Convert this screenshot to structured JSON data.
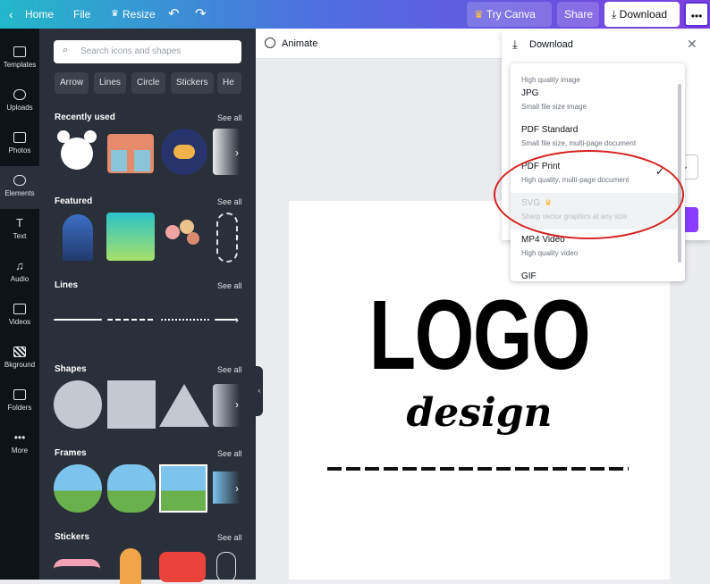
{
  "topbar": {
    "home": "Home",
    "file": "File",
    "resize": "Resize",
    "try": "Try Canva Pro",
    "share": "Share",
    "download": "Download"
  },
  "subbar": {
    "animate": "Animate"
  },
  "rail": [
    {
      "label": "Templates"
    },
    {
      "label": "Uploads"
    },
    {
      "label": "Photos"
    },
    {
      "label": "Elements"
    },
    {
      "label": "Text"
    },
    {
      "label": "Audio"
    },
    {
      "label": "Videos"
    },
    {
      "label": "Bkground"
    },
    {
      "label": "Folders"
    },
    {
      "label": "More"
    }
  ],
  "panel": {
    "search_placeholder": "Search icons and shapes",
    "chips": [
      "Arrow",
      "Lines",
      "Circle",
      "Stickers",
      "He"
    ],
    "see_all": "See all",
    "sections": [
      "Recently used",
      "Featured",
      "Lines",
      "Shapes",
      "Frames",
      "Stickers"
    ]
  },
  "canvas": {
    "logo": "LOGO",
    "design": "design"
  },
  "download_panel": {
    "title": "Download",
    "options": [
      {
        "title": "",
        "desc": "High quality image"
      },
      {
        "title": "JPG",
        "desc": "Small file size image"
      },
      {
        "title": "PDF Standard",
        "desc": "Small file size, multi-page document"
      },
      {
        "title": "PDF Print",
        "desc": "High quality, multi-page document"
      },
      {
        "title": "SVG",
        "desc": "Sharp vector graphics at any size"
      },
      {
        "title": "MP4 Video",
        "desc": "High quality video"
      },
      {
        "title": "GIF",
        "desc": ""
      }
    ]
  },
  "colors": {
    "accent": "#8b3dff",
    "highlight": "#d62020",
    "panel": "#293039"
  }
}
